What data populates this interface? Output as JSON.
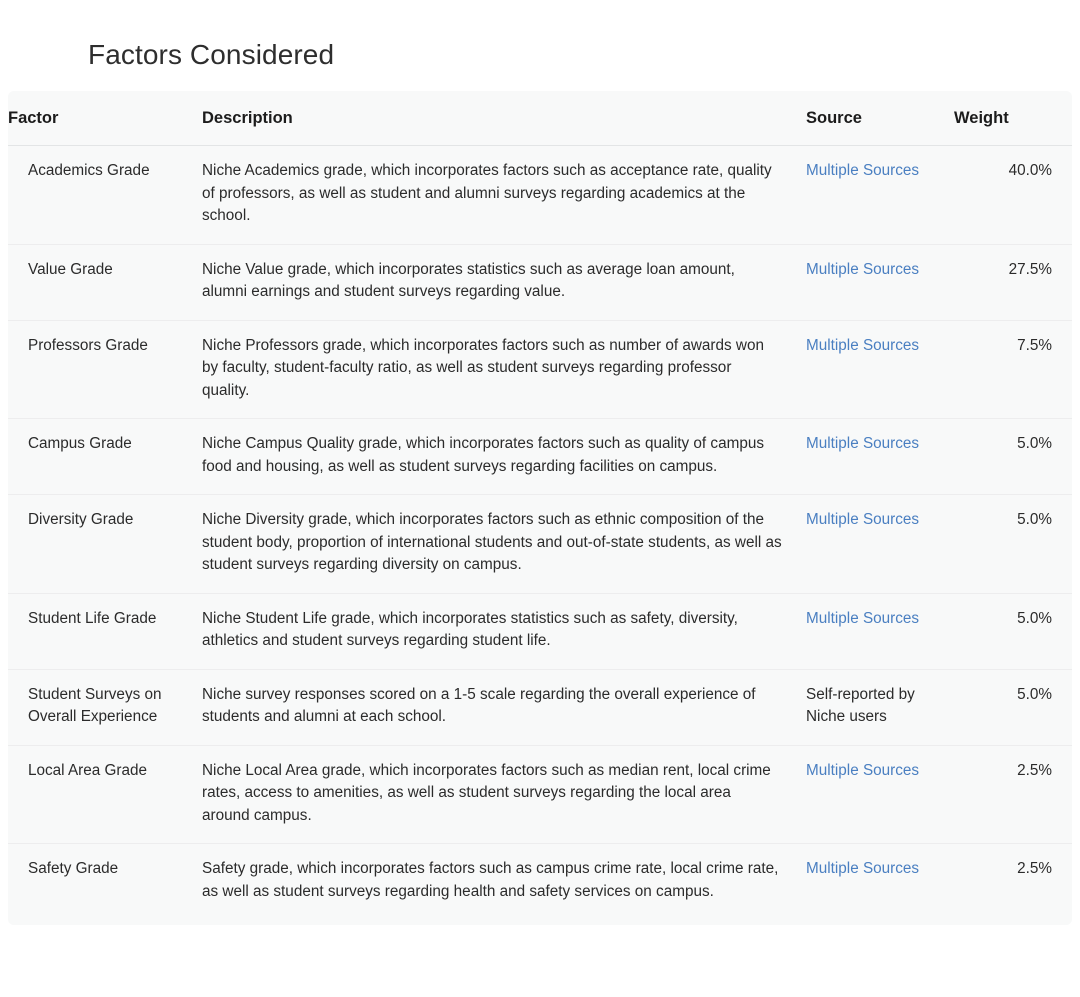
{
  "page": {
    "title": "Factors Considered",
    "background_color": "#ffffff",
    "table_background_color": "#f8f9f9",
    "link_color": "#4a7fc1",
    "text_color": "#2b2b2b"
  },
  "table": {
    "columns": [
      {
        "key": "factor",
        "label": "Factor"
      },
      {
        "key": "description",
        "label": "Description"
      },
      {
        "key": "source",
        "label": "Source"
      },
      {
        "key": "weight",
        "label": "Weight"
      }
    ],
    "rows": [
      {
        "factor": "Academics Grade",
        "description": "Niche Academics grade, which incorporates factors such as acceptance rate, quality of professors, as well as student and alumni surveys regarding academics at the school.",
        "source": "Multiple Sources",
        "source_is_link": true,
        "weight": "40.0%"
      },
      {
        "factor": "Value Grade",
        "description": "Niche Value grade, which incorporates statistics such as average loan amount, alumni earnings and student surveys regarding value.",
        "source": "Multiple Sources",
        "source_is_link": true,
        "weight": "27.5%"
      },
      {
        "factor": "Professors Grade",
        "description": "Niche Professors grade, which incorporates factors such as number of awards won by faculty, student-faculty ratio, as well as student surveys regarding professor quality.",
        "source": "Multiple Sources",
        "source_is_link": true,
        "weight": "7.5%"
      },
      {
        "factor": "Campus Grade",
        "description": "Niche Campus Quality grade, which incorporates factors such as quality of campus food and housing, as well as student surveys regarding facilities on campus.",
        "source": "Multiple Sources",
        "source_is_link": true,
        "weight": "5.0%"
      },
      {
        "factor": "Diversity Grade",
        "description": "Niche Diversity grade, which incorporates factors such as ethnic composition of the student body, proportion of international students and out-of-state students, as well as student surveys regarding diversity on campus.",
        "source": "Multiple Sources",
        "source_is_link": true,
        "weight": "5.0%"
      },
      {
        "factor": "Student Life Grade",
        "description": "Niche Student Life grade, which incorporates statistics such as safety, diversity, athletics and student surveys regarding student life.",
        "source": "Multiple Sources",
        "source_is_link": true,
        "weight": "5.0%"
      },
      {
        "factor": "Student Surveys on Overall Experience",
        "description": "Niche survey responses scored on a 1-5 scale regarding the overall experience of students and alumni at each school.",
        "source": "Self-reported by Niche users",
        "source_is_link": false,
        "weight": "5.0%"
      },
      {
        "factor": "Local Area Grade",
        "description": "Niche Local Area grade, which incorporates factors such as median rent, local crime rates, access to amenities, as well as student surveys regarding the local area around campus.",
        "source": "Multiple Sources",
        "source_is_link": true,
        "weight": "2.5%"
      },
      {
        "factor": "Safety Grade",
        "description": "Safety grade, which incorporates factors such as campus crime rate, local crime rate, as well as student surveys regarding health and safety services on campus.",
        "source": "Multiple Sources",
        "source_is_link": true,
        "weight": "2.5%"
      }
    ]
  }
}
